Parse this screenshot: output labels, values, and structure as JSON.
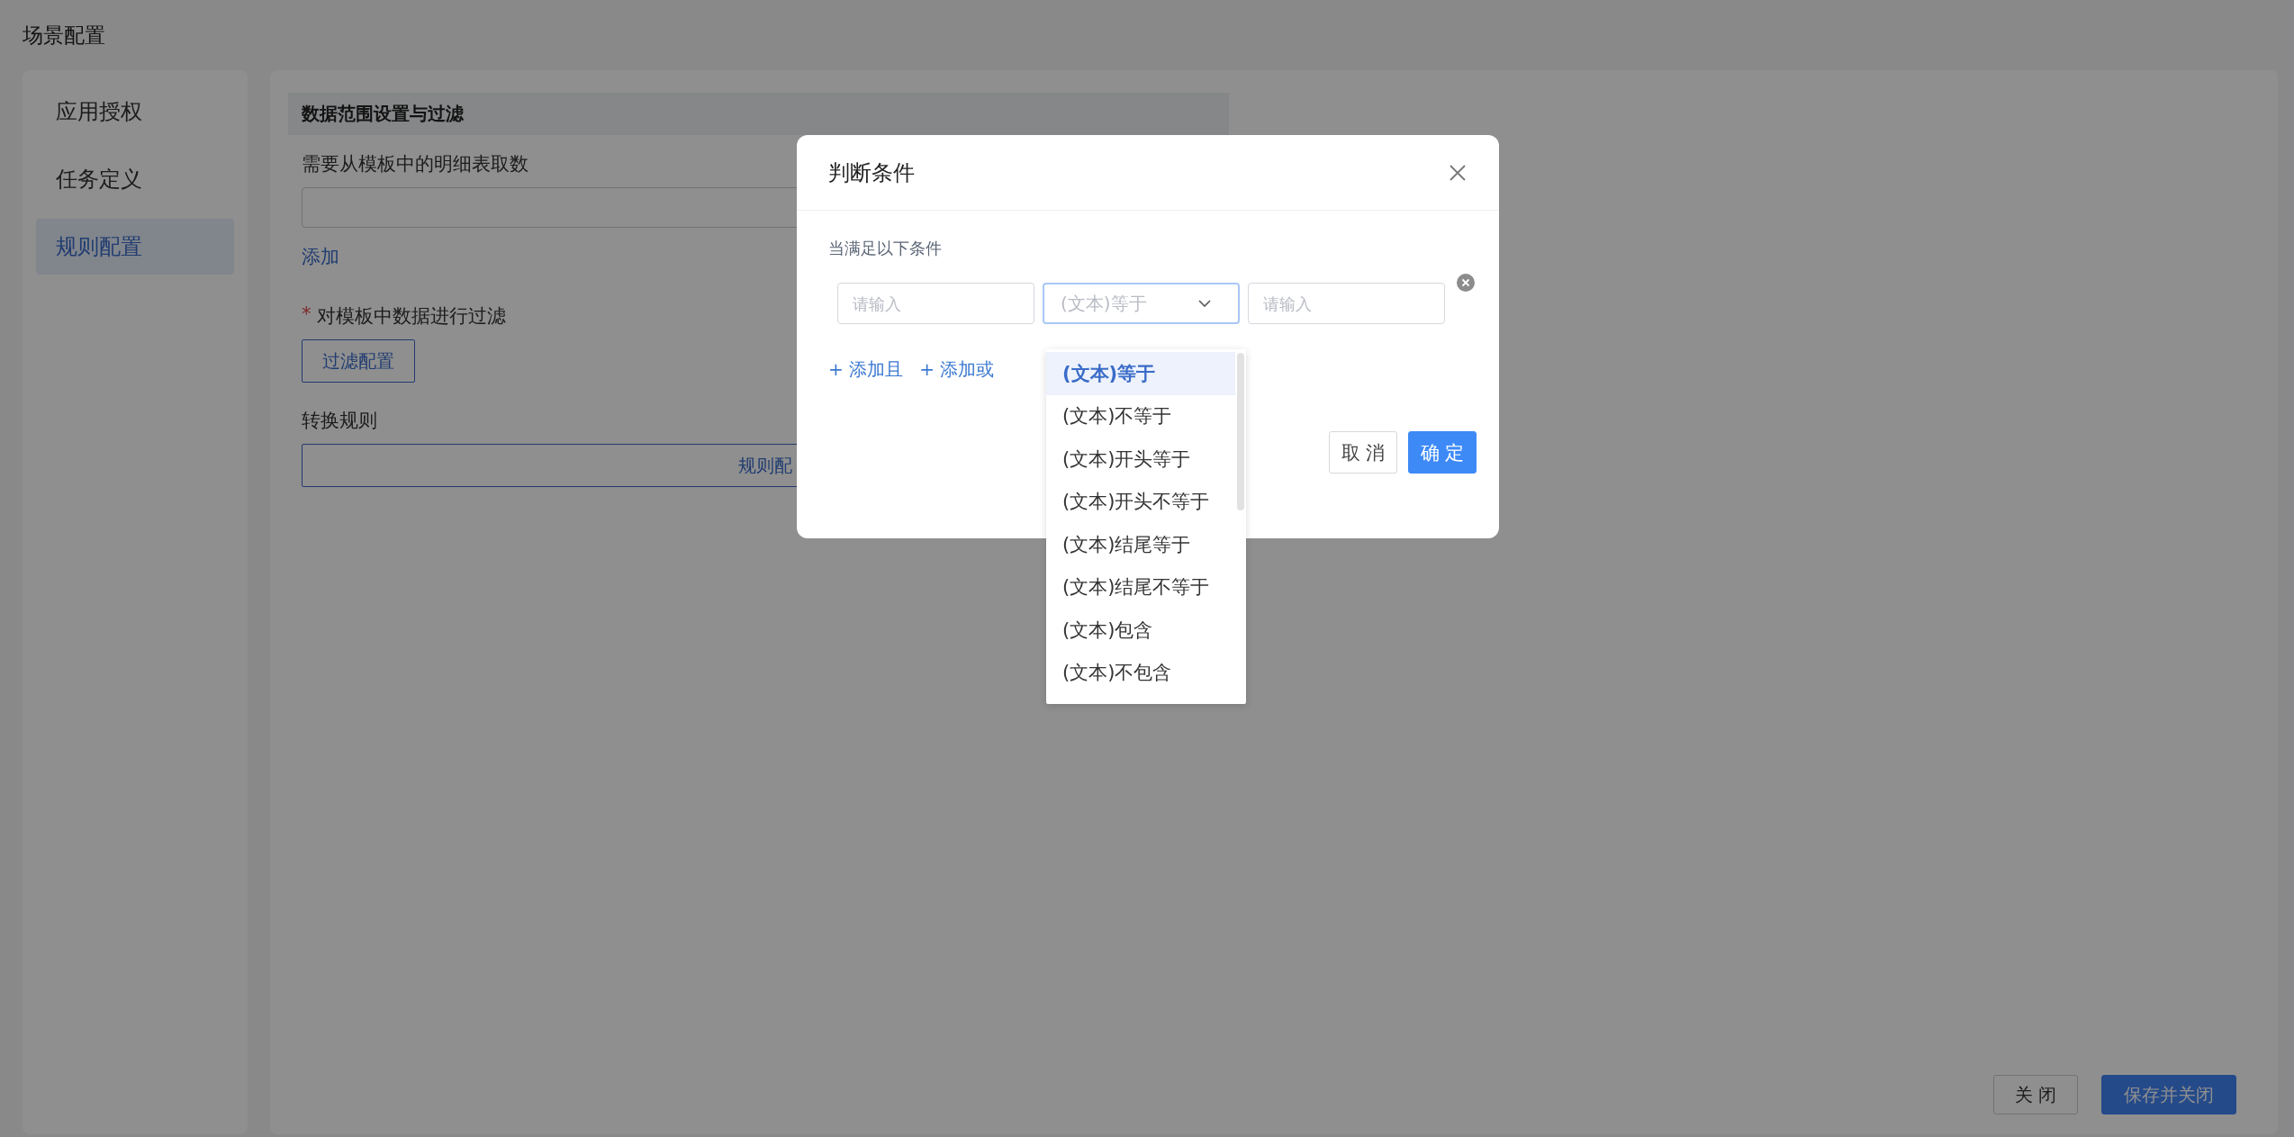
{
  "page": {
    "title": "场景配置"
  },
  "sidebar": {
    "items": [
      {
        "label": "应用授权",
        "selected": false
      },
      {
        "label": "任务定义",
        "selected": false
      },
      {
        "label": "规则配置",
        "selected": true
      }
    ]
  },
  "main": {
    "section_title": "数据范围设置与过滤",
    "detail_table": {
      "label": "需要从模板中的明细表取数"
    },
    "add_link": "添加",
    "filter": {
      "required_mark": "*",
      "label": "对模板中数据进行过滤",
      "button": "过滤配置"
    },
    "conversion": {
      "label": "转换规则",
      "button": "规则配"
    }
  },
  "footer_buttons": [
    {
      "label": "关 闭",
      "kind": "default"
    },
    {
      "label": "保存并关闭",
      "kind": "primary"
    }
  ],
  "dialog": {
    "title": "判断条件",
    "subtitle": "当满足以下条件",
    "condition": {
      "field_placeholder": "请输入",
      "operator_placeholder": "(文本)等于",
      "value_placeholder": "请输入"
    },
    "links": [
      "+ 添加且",
      "+ 添加或"
    ],
    "buttons": [
      {
        "label": "取 消",
        "kind": "default"
      },
      {
        "label": "确 定",
        "kind": "primary"
      }
    ],
    "dropdown": {
      "options": [
        {
          "label": "(文本)等于",
          "selected": true
        },
        {
          "label": "(文本)不等于",
          "selected": false
        },
        {
          "label": "(文本)开头等于",
          "selected": false
        },
        {
          "label": "(文本)开头不等于",
          "selected": false
        },
        {
          "label": "(文本)结尾等于",
          "selected": false
        },
        {
          "label": "(文本)结尾不等于",
          "selected": false
        },
        {
          "label": "(文本)包含",
          "selected": false
        },
        {
          "label": "(文本)不包含",
          "selected": false
        }
      ]
    }
  }
}
